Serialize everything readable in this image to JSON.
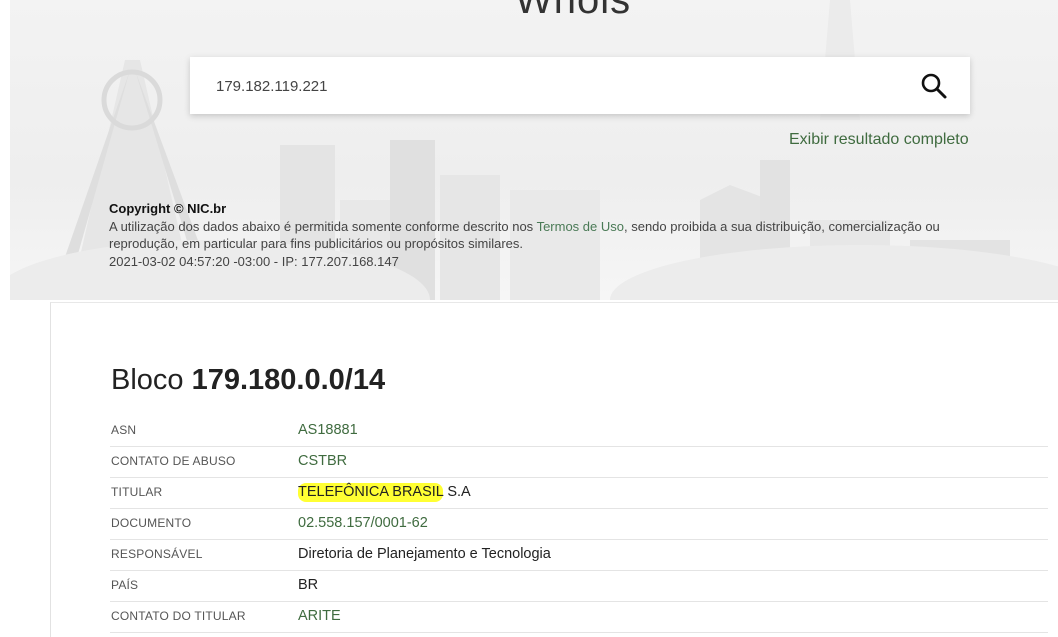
{
  "hero": {
    "title": "Whois"
  },
  "search": {
    "value": "179.182.119.221",
    "button_icon": "search-icon"
  },
  "full_result_link": "Exibir resultado completo",
  "copyright": {
    "title": "Copyright © NIC.br",
    "text_before": "A utilização dos dados abaixo é permitida somente conforme descrito nos ",
    "terms_link": "Termos de Uso",
    "text_after": ", sendo proibida a sua distribuição, comercialização ou reprodução, em particular para fins publicitários ou propósitos similares.",
    "timestamp": "2021-03-02 04:57:20 -03:00 - IP: 177.207.168.147"
  },
  "block": {
    "label": "Bloco",
    "cidr": "179.180.0.0/14",
    "rows": [
      {
        "label": "ASN",
        "value": "AS18881"
      },
      {
        "label": "CONTATO DE ABUSO",
        "value": "CSTBR"
      },
      {
        "label": "TITULAR",
        "value_highlight": "TELEFÔNICA BRASIL",
        "value_rest": " S.A"
      },
      {
        "label": "DOCUMENTO",
        "value": "02.558.157/0001-62"
      },
      {
        "label": "RESPONSÁVEL",
        "value": "Diretoria de Planejamento e Tecnologia"
      },
      {
        "label": "PAÍS",
        "value": "BR"
      },
      {
        "label": "CONTATO DO TITULAR",
        "value": "ARITE"
      }
    ]
  },
  "colors": {
    "link_green": "#3f6b3f",
    "highlight": "#ffff33"
  }
}
